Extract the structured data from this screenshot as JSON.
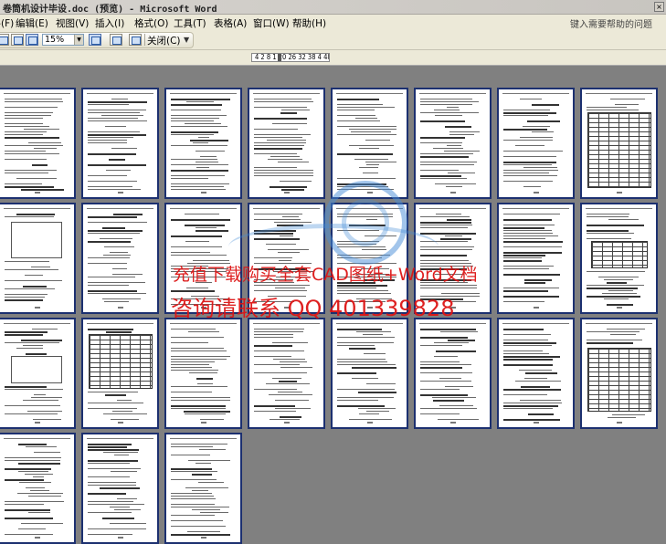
{
  "window": {
    "title": "卷筒机设计毕设.doc (预览) - Microsoft Word",
    "close_glyph": "×"
  },
  "menu": {
    "items": [
      {
        "label": "文件(F)"
      },
      {
        "label": "编辑(E)"
      },
      {
        "label": "视图(V)"
      },
      {
        "label": "插入(I)"
      },
      {
        "label": "格式(O)"
      },
      {
        "label": "工具(T)"
      },
      {
        "label": "表格(A)"
      },
      {
        "label": "窗口(W)"
      },
      {
        "label": "帮助(H)"
      }
    ],
    "help_placeholder": "键入需要帮助的问题"
  },
  "toolbar": {
    "zoom_value": "15%",
    "close_label": "关闭(C)",
    "icons": [
      "magnifier-icon",
      "one-page-icon",
      "multiple-pages-icon",
      "view-ruler-icon",
      "shrink-to-fit-icon",
      "full-screen-icon"
    ]
  },
  "ruler": {
    "text": "4 2 8 1 20 26 32 38 4 48"
  },
  "document": {
    "page_count": 27,
    "columns": 8
  },
  "watermark": {
    "line1": "充值下载购买全套CAD图纸+Word文档",
    "line2": "咨询请联系 QQ 401339828"
  },
  "colors": {
    "page_border": "#1c3070",
    "workspace": "#808080",
    "watermark_text": "#dc1414",
    "watermark_logo": "#468cd7"
  }
}
